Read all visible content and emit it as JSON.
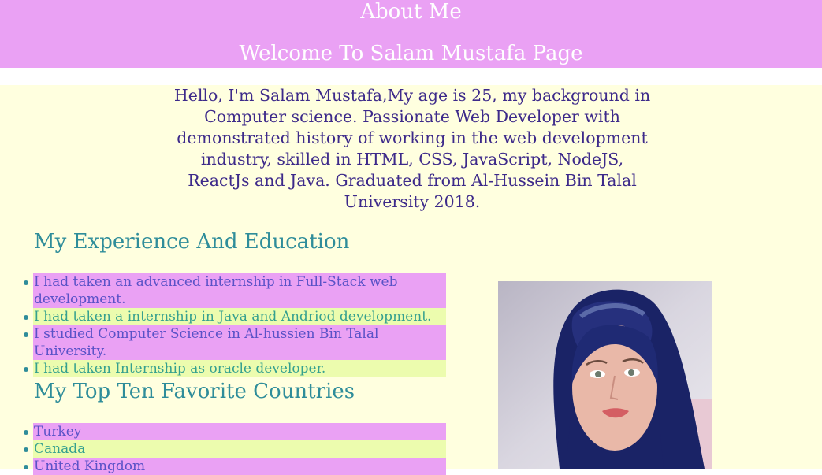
{
  "header": {
    "title": "About Me",
    "welcome": "Welcome To Salam Mustafa Page"
  },
  "intro": "Hello, I'm Salam Mustafa,My age is 25, my background in Computer science. Passionate Web Developer with demonstrated history of working in the web development industry, skilled in HTML, CSS, JavaScript, NodeJS, ReactJs and Java. Graduated from Al-Hussein Bin Talal University 2018.",
  "experience": {
    "heading": "My Experience And Education",
    "items": [
      "I had taken an advanced internship in Full-Stack web development.",
      "I had taken a internship in Java and Andriod development.",
      "I studied Computer Science in Al-hussien Bin Talal University.",
      "I had taken Internship as oracle developer."
    ]
  },
  "countries": {
    "heading": "My Top Ten Favorite Countries",
    "items": [
      "Turkey",
      "Canada",
      "United Kingdom"
    ]
  },
  "colors": {
    "header_bg": "#eaa1f4",
    "page_bg": "#ffffdf",
    "row_pink": "#eaa1f4",
    "row_lime": "#ecfcae",
    "heading": "#2f8d9a"
  }
}
